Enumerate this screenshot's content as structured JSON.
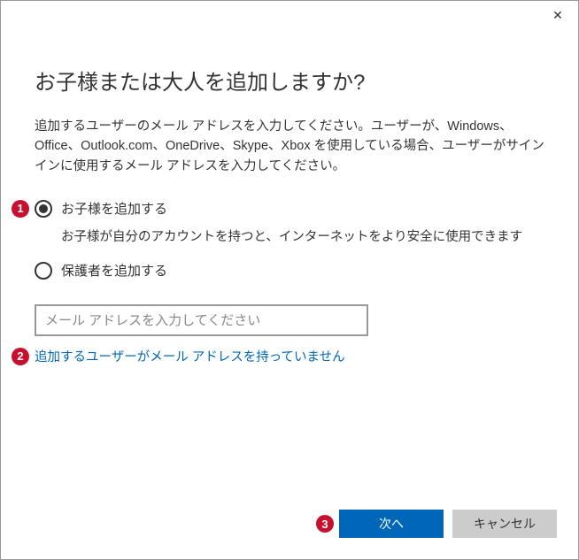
{
  "titlebar": {
    "close_glyph": "✕"
  },
  "heading": "お子様または大人を追加しますか?",
  "description": "追加するユーザーのメール アドレスを入力してください。ユーザーが、Windows、Office、Outlook.com、OneDrive、Skype、Xbox を使用している場合、ユーザーがサインインに使用するメール アドレスを入力してください。",
  "annotations": {
    "1": "1",
    "2": "2",
    "3": "3"
  },
  "radios": {
    "child": {
      "label": "お子様を追加する",
      "sub": "お子様が自分のアカウントを持つと、インターネットをより安全に使用できます"
    },
    "guardian": {
      "label": "保護者を追加する"
    }
  },
  "email": {
    "placeholder": "メール アドレスを入力してください"
  },
  "no_email_link": "追加するユーザーがメール アドレスを持っていません",
  "buttons": {
    "next": "次へ",
    "cancel": "キャンセル"
  }
}
